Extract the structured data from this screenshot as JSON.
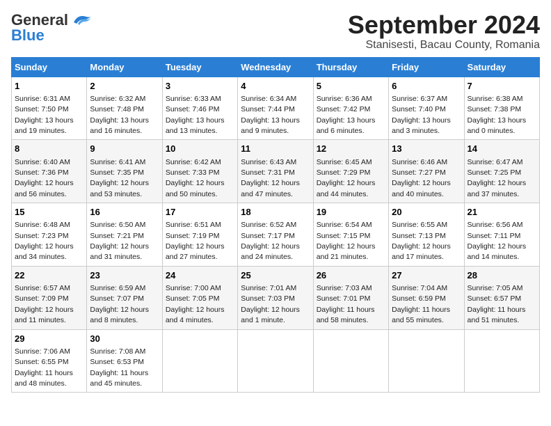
{
  "header": {
    "logo_line1": "General",
    "logo_line2": "Blue",
    "title": "September 2024",
    "subtitle": "Stanisesti, Bacau County, Romania"
  },
  "days_of_week": [
    "Sunday",
    "Monday",
    "Tuesday",
    "Wednesday",
    "Thursday",
    "Friday",
    "Saturday"
  ],
  "weeks": [
    [
      {
        "day": "1",
        "info": "Sunrise: 6:31 AM\nSunset: 7:50 PM\nDaylight: 13 hours and 19 minutes."
      },
      {
        "day": "2",
        "info": "Sunrise: 6:32 AM\nSunset: 7:48 PM\nDaylight: 13 hours and 16 minutes."
      },
      {
        "day": "3",
        "info": "Sunrise: 6:33 AM\nSunset: 7:46 PM\nDaylight: 13 hours and 13 minutes."
      },
      {
        "day": "4",
        "info": "Sunrise: 6:34 AM\nSunset: 7:44 PM\nDaylight: 13 hours and 9 minutes."
      },
      {
        "day": "5",
        "info": "Sunrise: 6:36 AM\nSunset: 7:42 PM\nDaylight: 13 hours and 6 minutes."
      },
      {
        "day": "6",
        "info": "Sunrise: 6:37 AM\nSunset: 7:40 PM\nDaylight: 13 hours and 3 minutes."
      },
      {
        "day": "7",
        "info": "Sunrise: 6:38 AM\nSunset: 7:38 PM\nDaylight: 13 hours and 0 minutes."
      }
    ],
    [
      {
        "day": "8",
        "info": "Sunrise: 6:40 AM\nSunset: 7:36 PM\nDaylight: 12 hours and 56 minutes."
      },
      {
        "day": "9",
        "info": "Sunrise: 6:41 AM\nSunset: 7:35 PM\nDaylight: 12 hours and 53 minutes."
      },
      {
        "day": "10",
        "info": "Sunrise: 6:42 AM\nSunset: 7:33 PM\nDaylight: 12 hours and 50 minutes."
      },
      {
        "day": "11",
        "info": "Sunrise: 6:43 AM\nSunset: 7:31 PM\nDaylight: 12 hours and 47 minutes."
      },
      {
        "day": "12",
        "info": "Sunrise: 6:45 AM\nSunset: 7:29 PM\nDaylight: 12 hours and 44 minutes."
      },
      {
        "day": "13",
        "info": "Sunrise: 6:46 AM\nSunset: 7:27 PM\nDaylight: 12 hours and 40 minutes."
      },
      {
        "day": "14",
        "info": "Sunrise: 6:47 AM\nSunset: 7:25 PM\nDaylight: 12 hours and 37 minutes."
      }
    ],
    [
      {
        "day": "15",
        "info": "Sunrise: 6:48 AM\nSunset: 7:23 PM\nDaylight: 12 hours and 34 minutes."
      },
      {
        "day": "16",
        "info": "Sunrise: 6:50 AM\nSunset: 7:21 PM\nDaylight: 12 hours and 31 minutes."
      },
      {
        "day": "17",
        "info": "Sunrise: 6:51 AM\nSunset: 7:19 PM\nDaylight: 12 hours and 27 minutes."
      },
      {
        "day": "18",
        "info": "Sunrise: 6:52 AM\nSunset: 7:17 PM\nDaylight: 12 hours and 24 minutes."
      },
      {
        "day": "19",
        "info": "Sunrise: 6:54 AM\nSunset: 7:15 PM\nDaylight: 12 hours and 21 minutes."
      },
      {
        "day": "20",
        "info": "Sunrise: 6:55 AM\nSunset: 7:13 PM\nDaylight: 12 hours and 17 minutes."
      },
      {
        "day": "21",
        "info": "Sunrise: 6:56 AM\nSunset: 7:11 PM\nDaylight: 12 hours and 14 minutes."
      }
    ],
    [
      {
        "day": "22",
        "info": "Sunrise: 6:57 AM\nSunset: 7:09 PM\nDaylight: 12 hours and 11 minutes."
      },
      {
        "day": "23",
        "info": "Sunrise: 6:59 AM\nSunset: 7:07 PM\nDaylight: 12 hours and 8 minutes."
      },
      {
        "day": "24",
        "info": "Sunrise: 7:00 AM\nSunset: 7:05 PM\nDaylight: 12 hours and 4 minutes."
      },
      {
        "day": "25",
        "info": "Sunrise: 7:01 AM\nSunset: 7:03 PM\nDaylight: 12 hours and 1 minute."
      },
      {
        "day": "26",
        "info": "Sunrise: 7:03 AM\nSunset: 7:01 PM\nDaylight: 11 hours and 58 minutes."
      },
      {
        "day": "27",
        "info": "Sunrise: 7:04 AM\nSunset: 6:59 PM\nDaylight: 11 hours and 55 minutes."
      },
      {
        "day": "28",
        "info": "Sunrise: 7:05 AM\nSunset: 6:57 PM\nDaylight: 11 hours and 51 minutes."
      }
    ],
    [
      {
        "day": "29",
        "info": "Sunrise: 7:06 AM\nSunset: 6:55 PM\nDaylight: 11 hours and 48 minutes."
      },
      {
        "day": "30",
        "info": "Sunrise: 7:08 AM\nSunset: 6:53 PM\nDaylight: 11 hours and 45 minutes."
      },
      null,
      null,
      null,
      null,
      null
    ]
  ]
}
